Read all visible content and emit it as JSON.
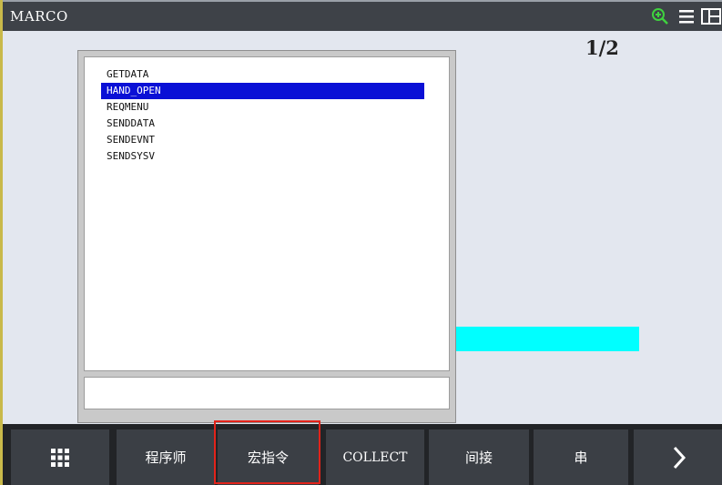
{
  "window": {
    "title": "MARCO",
    "page_indicator": "1/2",
    "title_icons": [
      "zoom-in-icon",
      "menu-icon",
      "split-view-icon"
    ]
  },
  "popup": {
    "items": [
      {
        "label": "GETDATA",
        "selected": false
      },
      {
        "label": "HAND_OPEN",
        "selected": true
      },
      {
        "label": "REQMENU",
        "selected": false
      },
      {
        "label": "SENDDATA",
        "selected": false
      },
      {
        "label": "SENDEVNT",
        "selected": false
      },
      {
        "label": "SENDSYSV",
        "selected": false
      }
    ],
    "input_value": ""
  },
  "function_keys": [
    {
      "label": "",
      "icon": "grid-menu-icon"
    },
    {
      "label": "程序师"
    },
    {
      "label": "宏指令",
      "highlighted": true
    },
    {
      "label": "COLLECT"
    },
    {
      "label": "间接"
    },
    {
      "label": "串"
    },
    {
      "label": "",
      "icon": "chevron-right-icon"
    }
  ],
  "colors": {
    "titlebar": "#3e4248",
    "selection": "#0a10d6",
    "cyan_bar": "#00ffff",
    "highlight_box": "#e2231a",
    "fkey_bg": "#3b3f45"
  }
}
